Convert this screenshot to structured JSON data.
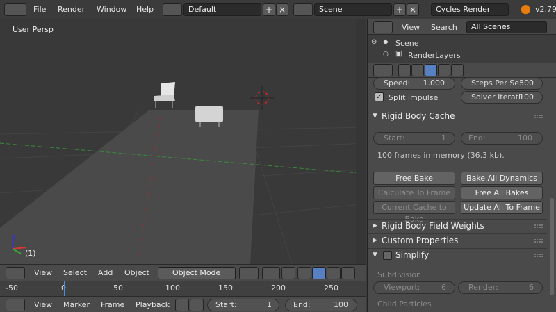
{
  "topbar": {
    "menus": [
      "File",
      "Render",
      "Window",
      "Help"
    ],
    "screen_layout": "Default",
    "scene": "Scene",
    "render_engine": "Cycles Render",
    "version": "v2.79"
  },
  "viewport": {
    "view_label": "User Persp",
    "frame_indicator": "(1)"
  },
  "viewport_header": {
    "menus": [
      "View",
      "Select",
      "Add",
      "Object"
    ],
    "mode": "Object Mode"
  },
  "timeline": {
    "ruler": [
      "-50",
      "0",
      "50",
      "100",
      "150",
      "200",
      "250"
    ]
  },
  "timeline_header": {
    "menus": [
      "View",
      "Marker",
      "Frame",
      "Playback"
    ],
    "start_label": "Start:",
    "start_value": "1",
    "end_label": "End:",
    "end_value": "100"
  },
  "outliner": {
    "menus": [
      "View",
      "Search"
    ],
    "filter": "All Scenes",
    "items": [
      "Scene",
      "RenderLayers"
    ]
  },
  "properties": {
    "speed_label": "Speed:",
    "speed_value": "1.000",
    "steps_label": "Steps Per Se:",
    "steps_value": "300",
    "split_impulse": "Split Impulse",
    "solver_label": "Solver Iterati:",
    "solver_value": "100",
    "rigid_body_cache": "Rigid Body Cache",
    "cache_start_label": "Start:",
    "cache_start_value": "1",
    "cache_end_label": "End:",
    "cache_end_value": "100",
    "memory_info": "100 frames in memory (36.3 kb).",
    "free_bake": "Free Bake",
    "bake_all_dynamics": "Bake All Dynamics",
    "calculate_to_frame": "Calculate To Frame",
    "free_all_bakes": "Free All Bakes",
    "current_cache_to_bake": "Current Cache to Bake",
    "update_all_to_frame": "Update All To Frame",
    "field_weights": "Rigid Body Field Weights",
    "custom_properties": "Custom Properties",
    "simplify": "Simplify",
    "subdivision": "Subdivision",
    "viewport_label": "Viewport:",
    "viewport_value": "6",
    "render_label": "Render:",
    "render_value": "6",
    "child_particles": "Child Particles"
  }
}
